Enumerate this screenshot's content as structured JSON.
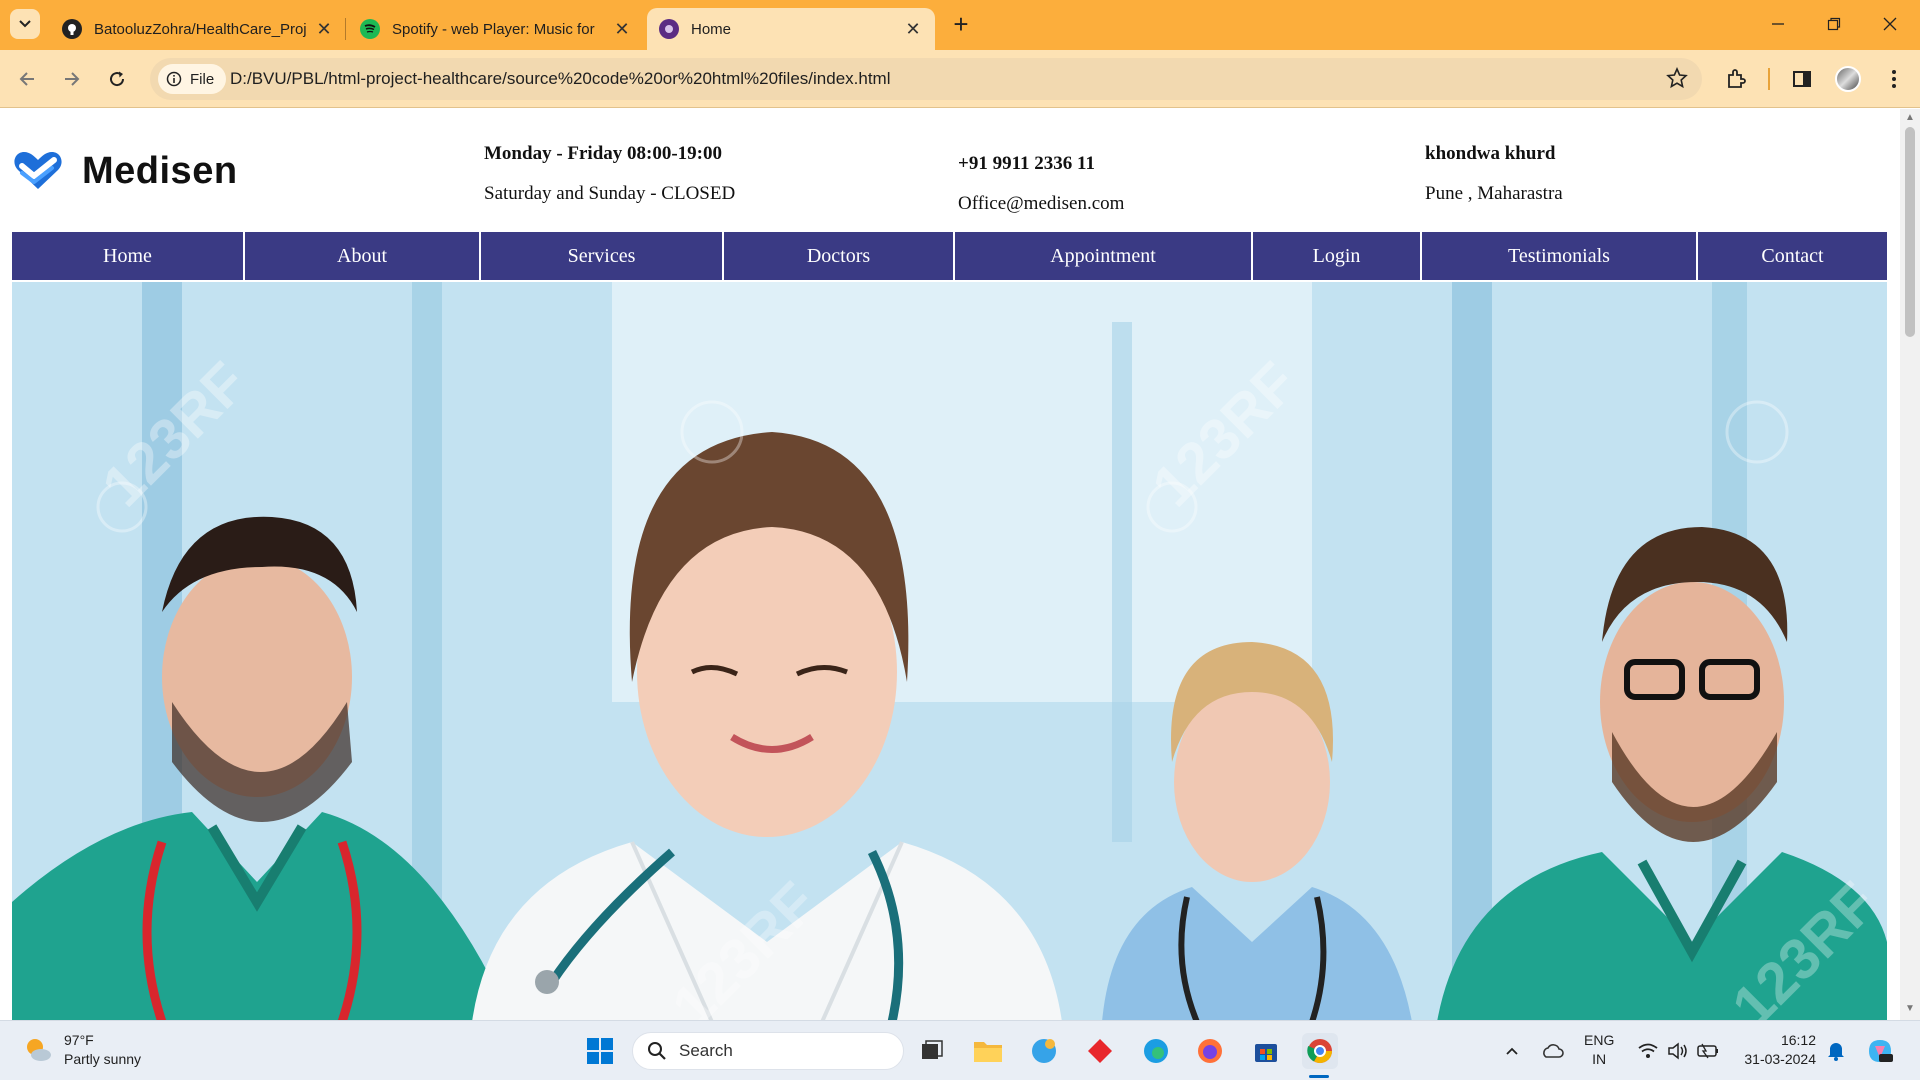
{
  "browser": {
    "tabs": [
      {
        "title": "BatooluzZohra/HealthCare_Proj",
        "favicon": "github-icon",
        "active": false
      },
      {
        "title": "Spotify - web Player: Music for",
        "favicon": "spotify-icon",
        "active": false
      },
      {
        "title": "Home",
        "favicon": "site-icon",
        "active": true
      }
    ],
    "site_chip": "File",
    "url": "D:/BVU/PBL/html-project-healthcare/source%20code%20or%20html%20files/index.html"
  },
  "page": {
    "logo_text": "Medisen",
    "hours": {
      "weekdays": "Monday - Friday 08:00-19:00",
      "weekend": "Saturday and Sunday - CLOSED"
    },
    "contact": {
      "phone": "+91 9911 2336 11",
      "email": "Office@medisen.com"
    },
    "address": {
      "line1": "khondwa khurd",
      "line2": "Pune , Maharastra"
    },
    "nav": [
      "Home",
      "About",
      "Services",
      "Doctors",
      "Appointment",
      "Login",
      "Testimonials",
      "Contact"
    ],
    "hero_watermark": "123RF"
  },
  "taskbar": {
    "weather": {
      "temp": "97°F",
      "condition": "Partly sunny"
    },
    "search_label": "Search",
    "lang": {
      "code": "ENG",
      "region": "IN"
    },
    "clock": {
      "time": "16:12",
      "date": "31-03-2024"
    }
  },
  "colors": {
    "tabbar": "#fcae3c",
    "toolbar": "#fde2b4",
    "nav": "#3a3a84",
    "logo_blue": "#1e6fd9"
  }
}
